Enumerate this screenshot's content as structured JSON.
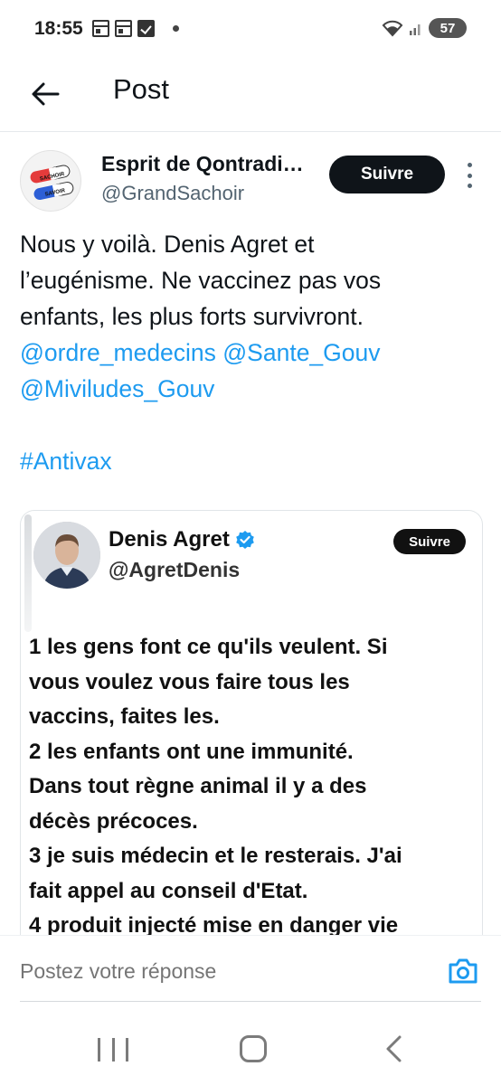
{
  "status_bar": {
    "time": "18:55",
    "battery": "57",
    "icons": [
      "calendar-icon",
      "calendar-icon",
      "checkbox-icon",
      "dot-icon",
      "wifi-icon",
      "signal-icon",
      "battery-icon"
    ]
  },
  "header": {
    "title": "Post"
  },
  "post": {
    "author_name": "Esprit de Qontradi…",
    "author_handle": "@GrandSachoir",
    "follow_label": "Suivre",
    "text_lines": [
      {
        "text": "Nous y voilà. Denis Agret et",
        "kind": "plain"
      },
      {
        "text": "l’eugénisme. Ne vaccinez pas vos",
        "kind": "plain"
      },
      {
        "text": "enfants, les plus forts survivront.",
        "kind": "plain"
      },
      {
        "text": "@ordre_medecins @Sante_Gouv",
        "kind": "mention"
      },
      {
        "text": "@Miviludes_Gouv",
        "kind": "mention"
      }
    ],
    "hashtag": "#Antivax",
    "avatar_label_top": "SACHOIR",
    "avatar_label_bottom": "SAVOIR"
  },
  "embed": {
    "author_name": "Denis Agret",
    "author_handle": "@AgretDenis",
    "follow_label": "Suivre",
    "verified": true,
    "lines": [
      "1 les gens font ce qu'ils veulent. Si",
      "vous voulez vous faire tous les",
      "vaccins, faites les.",
      "2 les enfants ont une immunité.",
      "Dans tout règne animal il y a des",
      "décès précoces.",
      "3 je suis médecin et le resterais. J'ai",
      "fait appel au conseil d'Etat.",
      "4 produit injecté mise en danger vie"
    ]
  },
  "reply": {
    "placeholder": "Postez votre réponse"
  },
  "colors": {
    "accent": "#1d9bf0",
    "text": "#0f1419",
    "secondary": "#536471",
    "button": "#0f1419"
  }
}
